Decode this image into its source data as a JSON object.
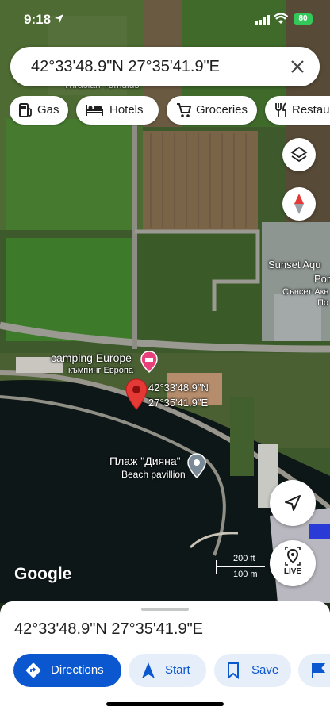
{
  "status_bar": {
    "time": "9:18",
    "battery": "80"
  },
  "search": {
    "query": "42°33'48.9\"N 27°35'41.9\"E"
  },
  "chips": [
    {
      "label": "Gas",
      "icon": "gas-station-icon"
    },
    {
      "label": "Hotels",
      "icon": "bed-icon"
    },
    {
      "label": "Groceries",
      "icon": "cart-icon"
    },
    {
      "label": "Restaurants",
      "icon": "restaurant-icon"
    }
  ],
  "map": {
    "labels": {
      "thracian_top": "Thracian Tumulus",
      "sunset_top": "Sunset Aqu",
      "sunset_mid": "Pon",
      "sunset_cyr": "Сънсет Акв",
      "sunset_cyr2": "По",
      "camping": "camping Europe",
      "camping_cyr": "къмпинг Европа",
      "pin_line1": "42°33'48.9\"N",
      "pin_line2": "27°35'41.9\"E",
      "beach_name": "Плаж \"Дияна\"",
      "beach_sub": "Beach pavillion"
    },
    "google_logo": "Google",
    "scale_ft": "200 ft",
    "scale_m": "100 m",
    "live_label": "LIVE",
    "colors": {
      "pin": "#e53935",
      "hotel_pin": "#e8407a",
      "beach_pin": "#7b8a97"
    }
  },
  "sheet": {
    "title": "42°33'48.9\"N 27°35'41.9\"E",
    "actions": {
      "directions": "Directions",
      "start": "Start",
      "save": "Save"
    }
  }
}
